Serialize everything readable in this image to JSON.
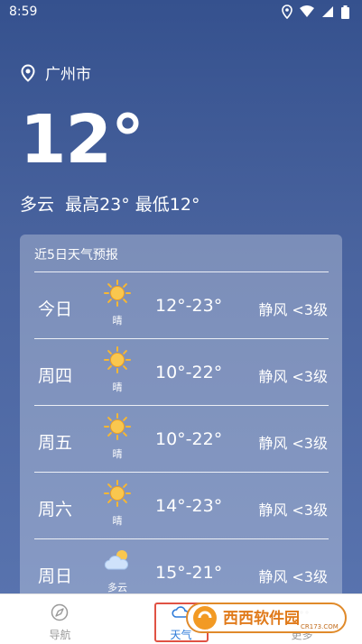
{
  "status_bar": {
    "time": "8:59",
    "icons": [
      "location-icon",
      "wifi-icon",
      "signal-icon",
      "battery-icon"
    ]
  },
  "location": {
    "name": "广州市",
    "icon": "location-pin-icon"
  },
  "current": {
    "temperature": "12°",
    "summary": "多云  最高23° 最低12°"
  },
  "forecast": {
    "title": "近5日天气预报",
    "rows": [
      {
        "day": "今日",
        "icon": "sun-icon",
        "desc": "晴",
        "range": "12°-23°",
        "wind": "静风 <3级"
      },
      {
        "day": "周四",
        "icon": "sun-icon",
        "desc": "晴",
        "range": "10°-22°",
        "wind": "静风 <3级"
      },
      {
        "day": "周五",
        "icon": "sun-icon",
        "desc": "晴",
        "range": "10°-22°",
        "wind": "静风 <3级"
      },
      {
        "day": "周六",
        "icon": "sun-icon",
        "desc": "晴",
        "range": "14°-23°",
        "wind": "静风 <3级"
      },
      {
        "day": "周日",
        "icon": "partly-cloudy-icon",
        "desc": "多云",
        "range": "15°-21°",
        "wind": "静风 <3级"
      }
    ]
  },
  "bottom_nav": {
    "items": [
      {
        "label": "导航",
        "icon": "compass-icon",
        "active": false
      },
      {
        "label": "天气",
        "icon": "cloud-icon",
        "active": true
      },
      {
        "label": "更多",
        "icon": "more-icon",
        "active": false
      }
    ]
  },
  "colors": {
    "background_top": "#35518e",
    "background_bottom": "#5a75b0",
    "active_tab": "#2e7bd9",
    "highlight_frame": "#e05244",
    "sun": "#f7b733"
  },
  "watermark": {
    "text": "西西软件园",
    "sub": "CR173.COM"
  }
}
